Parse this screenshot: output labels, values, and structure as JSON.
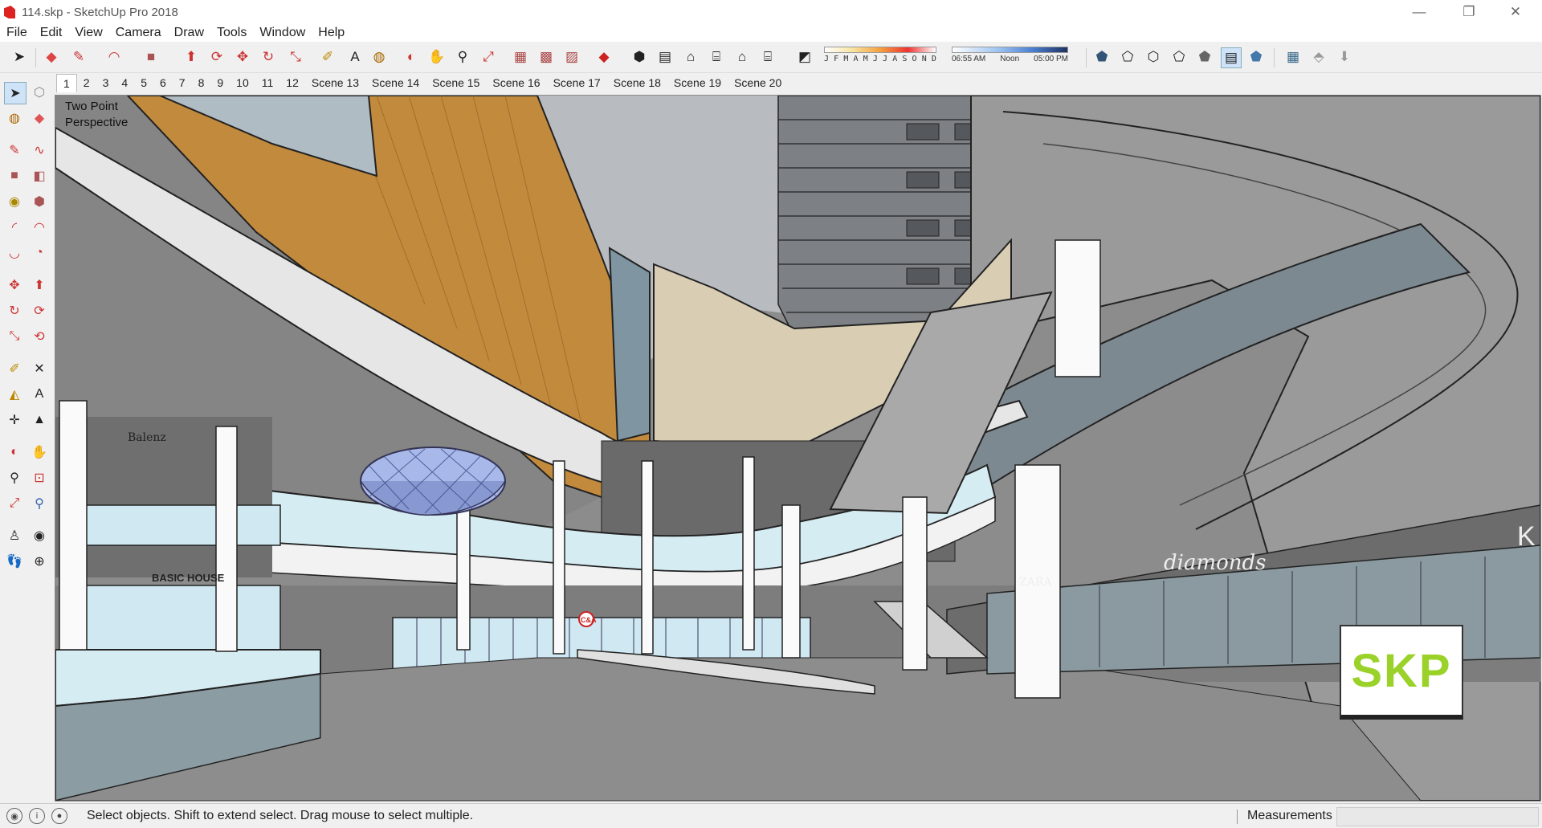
{
  "window": {
    "title": "114.skp - SketchUp Pro 2018",
    "minimize": "—",
    "restore": "❐",
    "close": "✕"
  },
  "menu": [
    "File",
    "Edit",
    "View",
    "Camera",
    "Draw",
    "Tools",
    "Window",
    "Help"
  ],
  "shadow_settings": {
    "months": [
      "J",
      "F",
      "M",
      "A",
      "M",
      "J",
      "J",
      "A",
      "S",
      "O",
      "N",
      "D"
    ],
    "time_start": "06:55 AM",
    "time_mid": "Noon",
    "time_end": "05:00 PM"
  },
  "scenes": [
    "1",
    "2",
    "3",
    "4",
    "5",
    "6",
    "7",
    "8",
    "9",
    "10",
    "11",
    "12",
    "Scene 13",
    "Scene 14",
    "Scene 15",
    "Scene 16",
    "Scene 17",
    "Scene 18",
    "Scene 19",
    "Scene 20"
  ],
  "active_scene": "1",
  "viewport": {
    "camera_label_line1": "Two Point",
    "camera_label_line2": "Perspective",
    "logo_text": "SKP"
  },
  "store_signs": [
    "Balenz",
    "BASIC HOUSE",
    "ZARA",
    "diamonds",
    "C&A",
    "K"
  ],
  "status": {
    "message": "Select objects. Shift to extend select. Drag mouse to select multiple.",
    "measurements_label": "Measurements",
    "measurements_value": ""
  },
  "colors": {
    "accent": "#9bd22a",
    "sky": "#b8bcc0",
    "wood": "#c28a3c",
    "glass": "#cfe8f2"
  }
}
